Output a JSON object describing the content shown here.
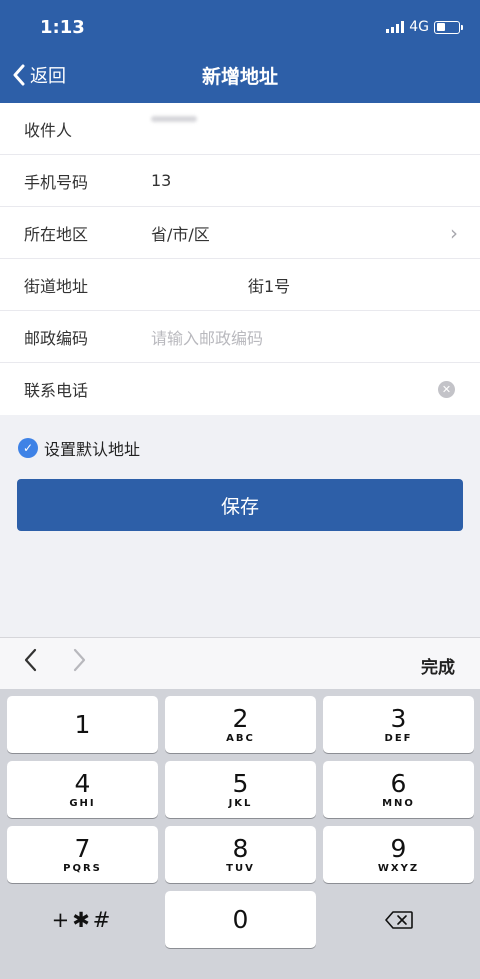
{
  "status_bar": {
    "time": "1:13",
    "network": "4G"
  },
  "nav": {
    "back_label": "返回",
    "title": "新增地址"
  },
  "form": {
    "rows": [
      {
        "label": "收件人",
        "value": "",
        "placeholder": ""
      },
      {
        "label": "手机号码",
        "value": "13",
        "placeholder": ""
      },
      {
        "label": "所在地区",
        "value": "省/市/区",
        "placeholder": ""
      },
      {
        "label": "街道地址",
        "value": "街1号",
        "placeholder": ""
      },
      {
        "label": "邮政编码",
        "value": "",
        "placeholder": "请输入邮政编码"
      },
      {
        "label": "联系电话",
        "value": "",
        "placeholder": ""
      }
    ]
  },
  "default_toggle": {
    "label": "设置默认地址",
    "checked": true
  },
  "save_button": {
    "label": "保存"
  },
  "accessory": {
    "done_label": "完成"
  },
  "keypad": {
    "keys": [
      {
        "digit": "1",
        "letters": ""
      },
      {
        "digit": "2",
        "letters": "ABC"
      },
      {
        "digit": "3",
        "letters": "DEF"
      },
      {
        "digit": "4",
        "letters": "GHI"
      },
      {
        "digit": "5",
        "letters": "JKL"
      },
      {
        "digit": "6",
        "letters": "MNO"
      },
      {
        "digit": "7",
        "letters": "PQRS"
      },
      {
        "digit": "8",
        "letters": "TUV"
      },
      {
        "digit": "9",
        "letters": "WXYZ"
      },
      {
        "digit": "0",
        "letters": ""
      }
    ],
    "symbols": "+✱#"
  },
  "colors": {
    "brand": "#2d5fa8",
    "check": "#3e82e6"
  }
}
